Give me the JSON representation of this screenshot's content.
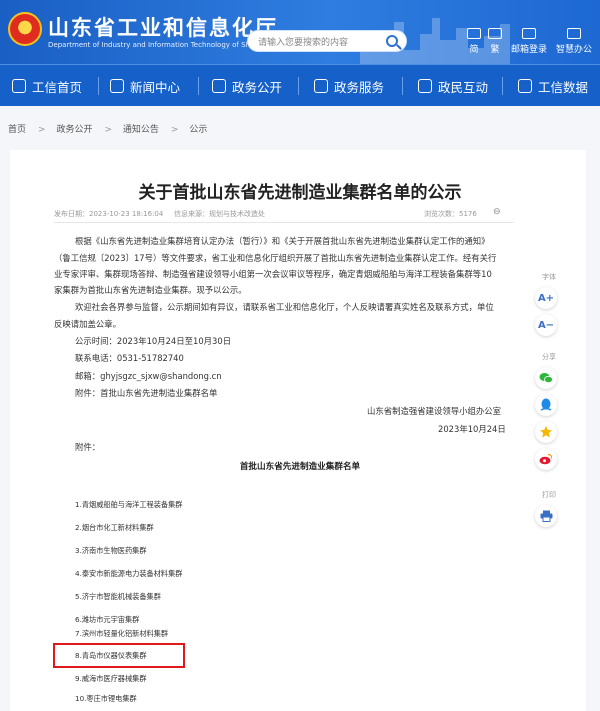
{
  "header": {
    "site_title": "山东省工业和信息化厅",
    "site_subtitle": "Department of Industry and Information Technology of Shandong Province",
    "search_placeholder": "请输入您要搜索的内容",
    "links": [
      {
        "label": "简",
        "icon": "simplified-icon"
      },
      {
        "label": "繁",
        "icon": "traditional-icon"
      },
      {
        "label": "邮箱登录",
        "icon": "mail-icon"
      },
      {
        "label": "智慧办公",
        "icon": "office-icon"
      }
    ]
  },
  "nav": {
    "items": [
      {
        "label": "工信首页",
        "icon": "home-icon"
      },
      {
        "label": "新闻中心",
        "icon": "news-icon"
      },
      {
        "label": "政务公开",
        "icon": "affairs-icon"
      },
      {
        "label": "政务服务",
        "icon": "service-icon"
      },
      {
        "label": "政民互动",
        "icon": "interaction-icon"
      },
      {
        "label": "工信数据",
        "icon": "data-icon"
      }
    ]
  },
  "breadcrumb": [
    "首页",
    "政务公开",
    "通知公告",
    "公示"
  ],
  "article": {
    "title": "关于首批山东省先进制造业集群名单的公示",
    "publish_date": "发布日期：2023-10-23 18:16:04",
    "source": "信息来源：规划与技术改造处",
    "views": "浏览次数：5176",
    "print_label": "⊖",
    "paragraphs": [
      "根据《山东省先进制造业集群培育认定办法（暂行）》和《关于开展首批山东省先进制造业集群认定工作的通知》",
      "（鲁工信规〔2023〕17号）等文件要求，省工业和信息化厅组织开展了首批山东省先进制造业集群认定工作。经有关行",
      "业专家评审、集群现场答辩、制造强省建设领导小组第一次会议审议等程序，确定青烟威船舶与海洋工程装备集群等10",
      "家集群为首批山东省先进制造业集群。现予以公示。",
      "欢迎社会各界参与监督，公示期间如有异议，请联系省工业和信息化厅，个人反映请署真实姓名及联系方式，单位",
      "反映请加盖公章。"
    ],
    "contact": [
      "公示时间：2023年10月24日至10月30日",
      "联系电话：0531-51782740",
      "邮箱：ghyjsgzc_sjxw@shandong.cn",
      "附件：首批山东省先进制造业集群名单"
    ],
    "signature": "山东省制造强省建设领导小组办公室",
    "sign_date": "2023年10月24日",
    "attachment_label": "附件：",
    "list_title": "首批山东省先进制造业集群名单",
    "clusters": [
      "1.青烟威船舶与海洋工程装备集群",
      "2.烟台市化工新材料集群",
      "3.济南市生物医药集群",
      "4.泰安市新能源电力装备材料集群",
      "5.济宁市智能机械装备集群",
      "6.潍坊市元宇宙集群",
      "7.滨州市轻量化铝新材料集群",
      "8.青岛市仪器仪表集群",
      "9.威海市医疗器械集群",
      "10.枣庄市锂电集群"
    ]
  },
  "sidebar": {
    "font_label": "字体",
    "font_up": "A+",
    "font_down": "A−",
    "share_label": "分享",
    "print_label": "打印"
  },
  "colors": {
    "header_blue": "#1a5fc4",
    "nav_blue": "#1560c9",
    "highlight_red": "#e0191b"
  }
}
